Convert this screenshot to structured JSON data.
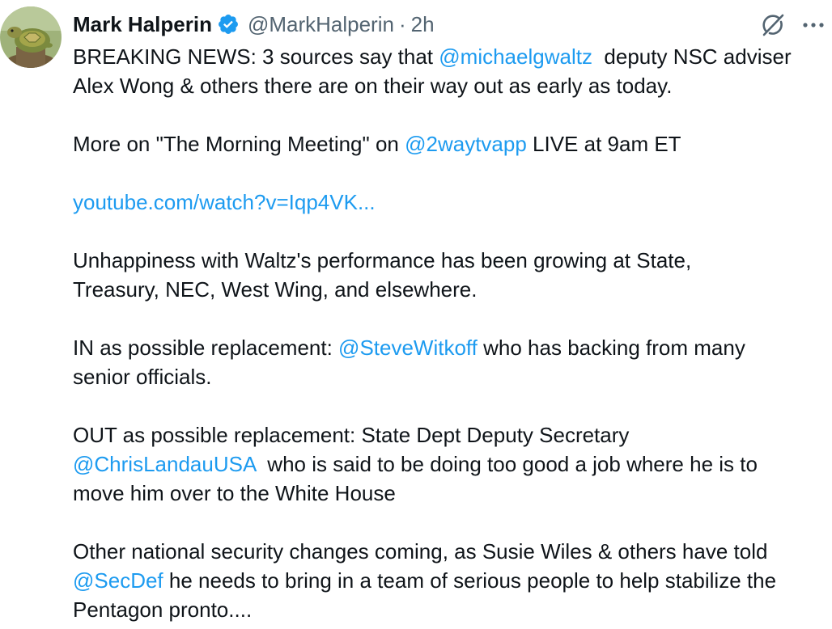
{
  "author": {
    "display_name": "Mark Halperin",
    "handle": "@MarkHalperin",
    "separator": "·",
    "timestamp": "2h",
    "verified_color": "#1d9bf0",
    "avatar_icon": "turtle-avatar"
  },
  "icons": {
    "verified": "verified-badge-icon",
    "grok": "grok-icon",
    "more": "more-options-icon"
  },
  "colors": {
    "link": "#1d9bf0",
    "text": "#0f1419",
    "secondary": "#536471"
  },
  "tweet": {
    "p1": {
      "t1": "BREAKING NEWS: 3 sources say that ",
      "mention": "@michaelgwaltz",
      "t2": "  deputy NSC adviser",
      "t3": "Alex Wong & others there are on their way out as early as today."
    },
    "p2": {
      "t1": "More on \"The Morning Meeting\" on ",
      "mention": "@2waytvapp",
      "t2": " LIVE at 9am ET"
    },
    "p3": {
      "link": "youtube.com/watch?v=Iqp4VK..."
    },
    "p4": {
      "t1": "Unhappiness with Waltz's performance has been growing at State,",
      "t2": "Treasury, NEC, West Wing, and elsewhere."
    },
    "p5": {
      "t1": "IN as possible replacement: ",
      "mention": "@SteveWitkoff",
      "t2": " who has backing from many",
      "t3": "senior officials."
    },
    "p6": {
      "t1": "OUT as possible replacement: State Dept Deputy Secretary",
      "mention": "@ChrisLandauUSA",
      "t2": "  who is said to be doing too good a job where he is to",
      "t3": "move him over to the White House"
    },
    "p7": {
      "t1": "Other national security changes coming, as Susie Wiles & others have told",
      "mention": "@SecDef",
      "t2": " he needs to bring in a team of serious people to help stabilize the",
      "t3": "Pentagon pronto...."
    }
  }
}
